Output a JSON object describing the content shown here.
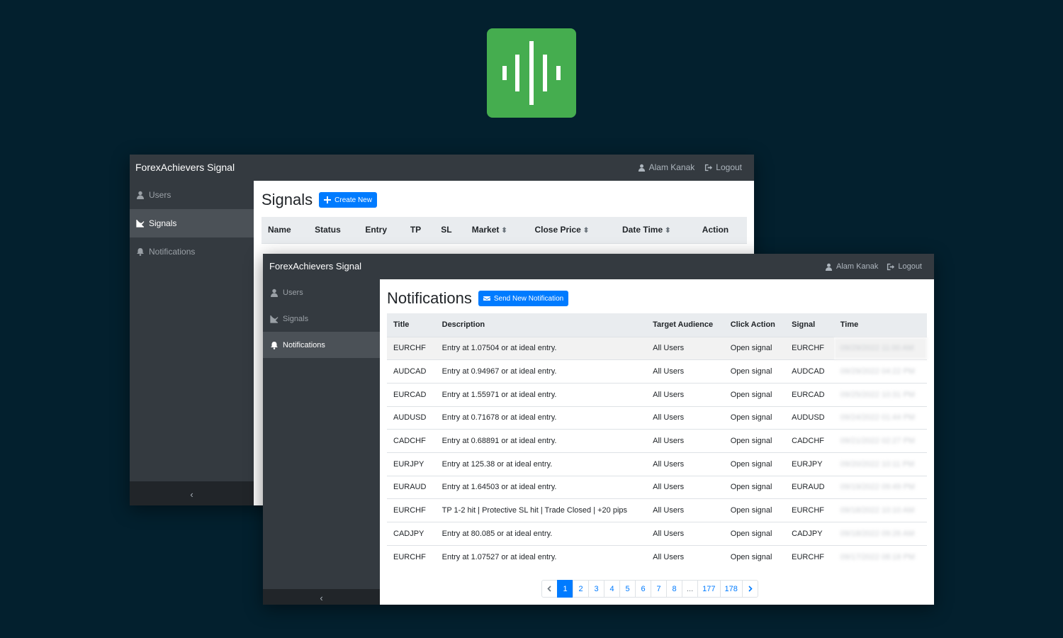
{
  "colors": {
    "background": "#03202e",
    "logo_green": "#45ad4f",
    "navbar": "#343a40",
    "primary": "#007bff"
  },
  "logo": {
    "icon": "audio-wave-icon"
  },
  "back_window": {
    "brand": "ForexAchievers Signal",
    "user": "Alam Kanak",
    "logout": "Logout",
    "sidebar": [
      {
        "label": "Users",
        "icon": "user-icon"
      },
      {
        "label": "Signals",
        "icon": "chart-line-icon",
        "active": true
      },
      {
        "label": "Notifications",
        "icon": "bell-icon"
      }
    ],
    "collapse": "‹",
    "title": "Signals",
    "create_button": "Create New",
    "columns": [
      "Name",
      "Status",
      "Entry",
      "TP",
      "SL",
      "Market",
      "Close Price",
      "Date Time",
      "Action"
    ]
  },
  "front_window": {
    "brand": "ForexAchievers Signal",
    "user": "Alam Kanak",
    "logout": "Logout",
    "sidebar": [
      {
        "label": "Users",
        "icon": "user-icon"
      },
      {
        "label": "Signals",
        "icon": "chart-line-icon"
      },
      {
        "label": "Notifications",
        "icon": "bell-icon",
        "active": true
      }
    ],
    "collapse": "‹",
    "title": "Notifications",
    "send_button": "Send New Notification",
    "columns": [
      "Title",
      "Description",
      "Target Audience",
      "Click Action",
      "Signal",
      "Time"
    ],
    "rows": [
      {
        "title": "EURCHF",
        "description": "Entry at 1.07504 or at ideal entry.",
        "audience": "All Users",
        "action": "Open signal",
        "signal": "EURCHF",
        "time": "09/29/2022 11:00 AM"
      },
      {
        "title": "AUDCAD",
        "description": "Entry at 0.94967 or at ideal entry.",
        "audience": "All Users",
        "action": "Open signal",
        "signal": "AUDCAD",
        "time": "09/29/2022 04:22 PM"
      },
      {
        "title": "EURCAD",
        "description": "Entry at 1.55971 or at ideal entry.",
        "audience": "All Users",
        "action": "Open signal",
        "signal": "EURCAD",
        "time": "09/25/2022 10:31 PM"
      },
      {
        "title": "AUDUSD",
        "description": "Entry at 0.71678 or at ideal entry.",
        "audience": "All Users",
        "action": "Open signal",
        "signal": "AUDUSD",
        "time": "09/24/2022 01:44 PM"
      },
      {
        "title": "CADCHF",
        "description": "Entry at 0.68891 or at ideal entry.",
        "audience": "All Users",
        "action": "Open signal",
        "signal": "CADCHF",
        "time": "09/21/2022 02:27 PM"
      },
      {
        "title": "EURJPY",
        "description": "Entry at 125.38 or at ideal entry.",
        "audience": "All Users",
        "action": "Open signal",
        "signal": "EURJPY",
        "time": "09/20/2022 10:11 PM"
      },
      {
        "title": "EURAUD",
        "description": "Entry at 1.64503 or at ideal entry.",
        "audience": "All Users",
        "action": "Open signal",
        "signal": "EURAUD",
        "time": "09/19/2022 09:49 PM"
      },
      {
        "title": "EURCHF",
        "description": "TP 1-2 hit | Protective SL hit | Trade Closed | +20 pips",
        "audience": "All Users",
        "action": "Open signal",
        "signal": "EURCHF",
        "time": "09/18/2022 10:10 AM"
      },
      {
        "title": "CADJPY",
        "description": "Entry at 80.085 or at ideal entry.",
        "audience": "All Users",
        "action": "Open signal",
        "signal": "CADJPY",
        "time": "09/18/2022 09:26 AM"
      },
      {
        "title": "EURCHF",
        "description": "Entry at 1.07527 or at ideal entry.",
        "audience": "All Users",
        "action": "Open signal",
        "signal": "EURCHF",
        "time": "09/17/2022 08:18 PM"
      }
    ],
    "pagination": {
      "pages": [
        "1",
        "2",
        "3",
        "4",
        "5",
        "6",
        "7",
        "8",
        "...",
        "177",
        "178"
      ],
      "current": "1"
    }
  }
}
